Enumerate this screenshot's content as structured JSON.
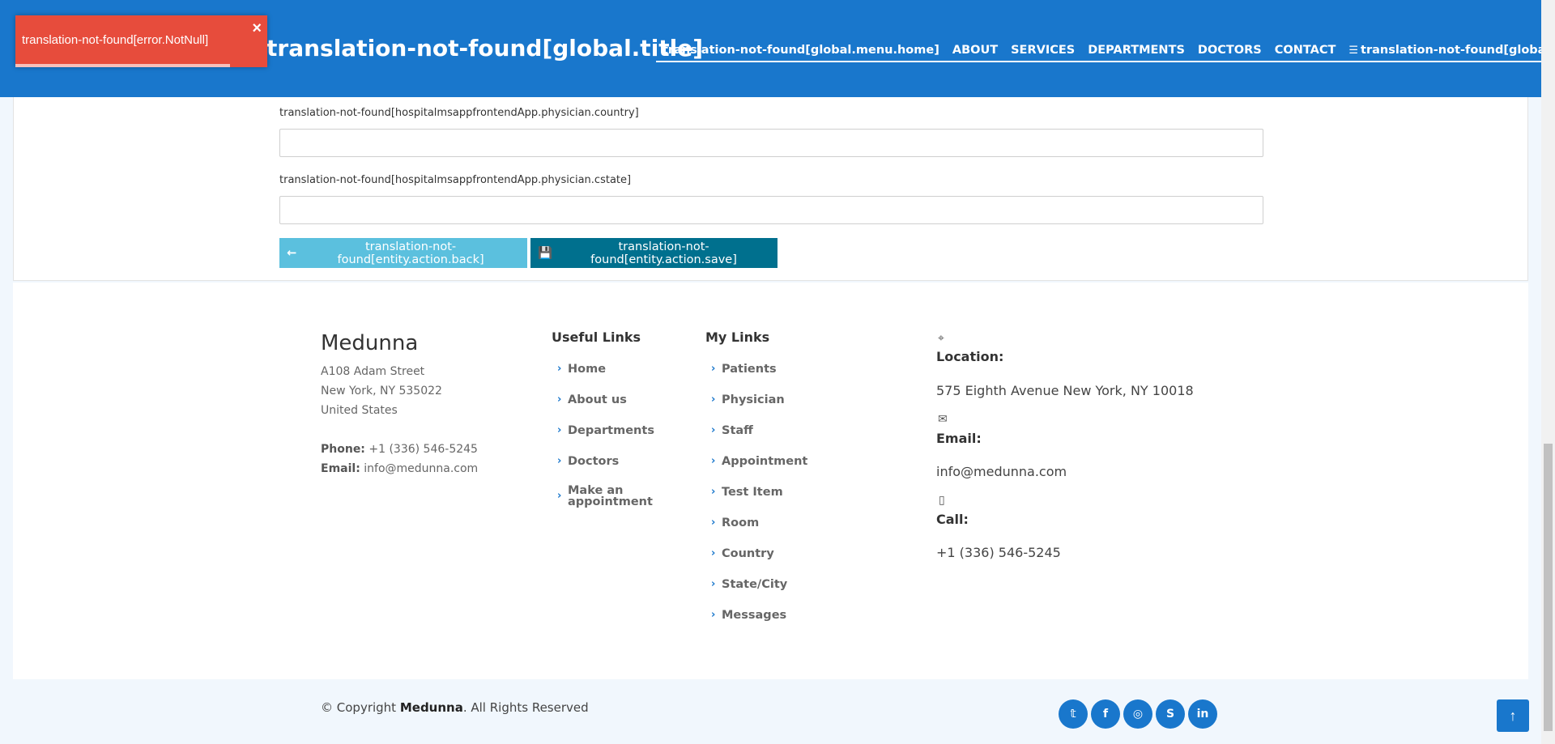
{
  "header": {
    "site_title": "translation-not-found[global.title]",
    "nav": [
      "translation-not-found[global.menu.home]",
      "ABOUT",
      "SERVICES",
      "DEPARTMENTS",
      "DOCTORS",
      "CONTACT",
      "translation-not-found[global.menu.entities.main]"
    ]
  },
  "toast": {
    "message": "translation-not-found[error.NotNull]",
    "close": "×"
  },
  "form": {
    "country_label": "translation-not-found[hospitalmsappfrontendApp.physician.country]",
    "country_value": "",
    "cstate_label": "translation-not-found[hospitalmsappfrontendApp.physician.cstate]",
    "cstate_value": "",
    "back_label": "translation-not-found[entity.action.back]",
    "save_label": "translation-not-found[entity.action.save]"
  },
  "footer": {
    "brand": "Medunna",
    "address": [
      "A108 Adam Street",
      "New York, NY 535022",
      "United States"
    ],
    "phone_label": "Phone:",
    "phone": "+1 (336) 546-5245",
    "email_label": "Email:",
    "email": "info@medunna.com",
    "useful_links_title": "Useful Links",
    "useful_links": [
      "Home",
      "About us",
      "Departments",
      "Doctors",
      "Make an",
      "appointment"
    ],
    "my_links_title": "My Links",
    "my_links": [
      "Patients",
      "Physician",
      "Staff",
      "Appointment",
      "Test Item",
      "Room",
      "Country",
      "State/City",
      "Messages"
    ],
    "contact": {
      "location_label": "Location:",
      "location": "575 Eighth Avenue New York, NY 10018",
      "email_label": "Email:",
      "email": "info@medunna.com",
      "call_label": "Call:",
      "call": "+1 (336) 546-5245"
    },
    "copyright_prefix": "© Copyright",
    "copyright_brand": "Medunna",
    "copyright_suffix": ". All Rights Reserved",
    "social": [
      "twitter-icon",
      "facebook-icon",
      "instagram-icon",
      "skype-icon",
      "linkedin-icon"
    ]
  },
  "colors": {
    "primary": "#1977cc",
    "toast_error": "#e74c3c",
    "back_button": "#5bc0de",
    "save_button": "#00708e"
  }
}
